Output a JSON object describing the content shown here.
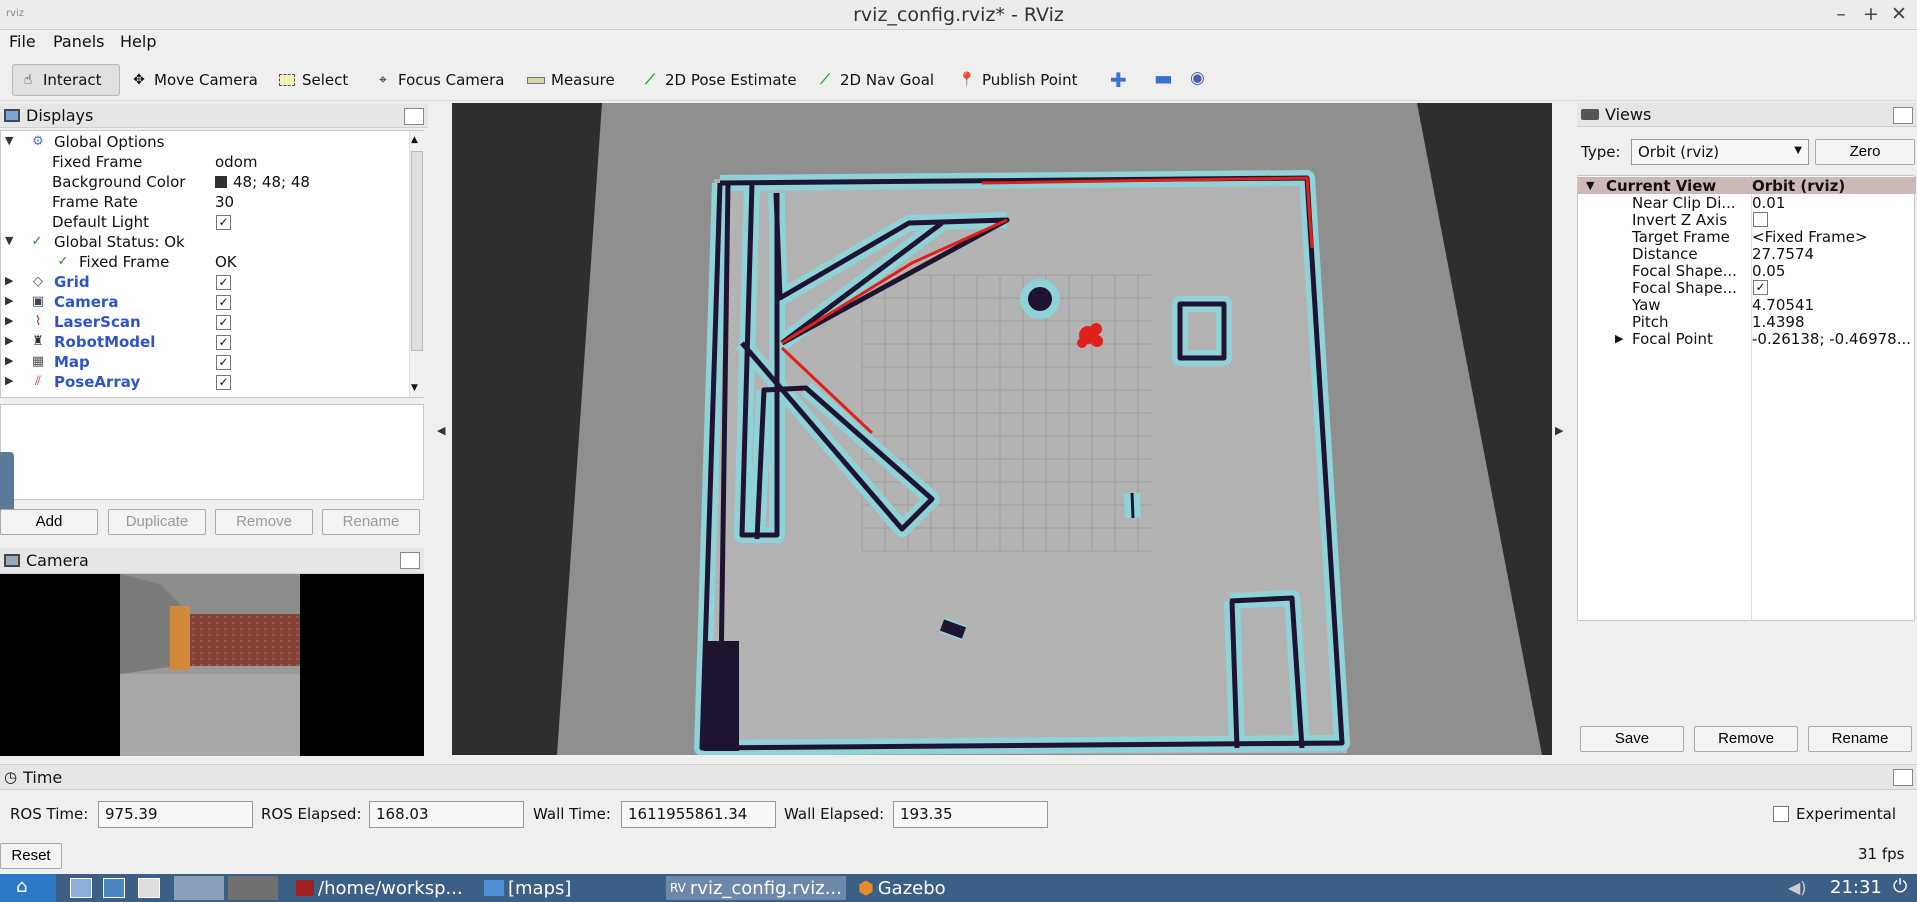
{
  "window": {
    "title": "rviz_config.rviz* - RViz",
    "app_label": "rviz"
  },
  "menu": [
    "File",
    "Panels",
    "Help"
  ],
  "toolbar": [
    {
      "label": "Interact",
      "icon": "cursor-icon",
      "active": true
    },
    {
      "label": "Move Camera",
      "icon": "move-icon"
    },
    {
      "label": "Select",
      "icon": "select-icon"
    },
    {
      "label": "Focus Camera",
      "icon": "focus-icon"
    },
    {
      "label": "Measure",
      "icon": "ruler-icon"
    },
    {
      "label": "2D Pose Estimate",
      "icon": "green-arrow-icon"
    },
    {
      "label": "2D Nav Goal",
      "icon": "green-arrow-icon"
    },
    {
      "label": "Publish Point",
      "icon": "pin-icon"
    }
  ],
  "displays": {
    "title": "Displays",
    "rows": [
      {
        "key": "Global Options",
        "expanded": true
      },
      {
        "key": "Fixed Frame",
        "value": "odom"
      },
      {
        "key": "Background Color",
        "value": "48; 48; 48"
      },
      {
        "key": "Frame Rate",
        "value": "30"
      },
      {
        "key": "Default Light",
        "value": "✓"
      },
      {
        "key": "Global Status: Ok",
        "expanded": true
      },
      {
        "key": "Fixed Frame",
        "value": "OK"
      },
      {
        "key": "Grid",
        "value": "✓"
      },
      {
        "key": "Camera",
        "value": "✓"
      },
      {
        "key": "LaserScan",
        "value": "✓"
      },
      {
        "key": "RobotModel",
        "value": "✓"
      },
      {
        "key": "Map",
        "value": "✓"
      },
      {
        "key": "PoseArray",
        "value": "✓"
      }
    ],
    "buttons": [
      "Add",
      "Duplicate",
      "Remove",
      "Rename"
    ]
  },
  "camera_panel": {
    "title": "Camera"
  },
  "views": {
    "title": "Views",
    "type_label": "Type:",
    "type_value": "Orbit (rviz)",
    "zero": "Zero",
    "current_view": "Current View",
    "current_view_value": "Orbit (rviz)",
    "props": [
      {
        "key": "Near Clip Di...",
        "value": "0.01"
      },
      {
        "key": "Invert Z Axis",
        "value": ""
      },
      {
        "key": "Target Frame",
        "value": "<Fixed Frame>"
      },
      {
        "key": "Distance",
        "value": "27.7574"
      },
      {
        "key": "Focal Shape...",
        "value": "0.05"
      },
      {
        "key": "Focal Shape...",
        "value": "✓"
      },
      {
        "key": "Yaw",
        "value": "4.70541"
      },
      {
        "key": "Pitch",
        "value": "1.4398"
      },
      {
        "key": "Focal Point",
        "value": "-0.26138; -0.46978..."
      }
    ],
    "buttons": [
      "Save",
      "Remove",
      "Rename"
    ]
  },
  "time": {
    "title": "Time",
    "ros_time_label": "ROS Time:",
    "ros_time": "975.39",
    "ros_elapsed_label": "ROS Elapsed:",
    "ros_elapsed": "168.03",
    "wall_time_label": "Wall Time:",
    "wall_time": "1611955861.34",
    "wall_elapsed_label": "Wall Elapsed:",
    "wall_elapsed": "193.35",
    "experimental": "Experimental",
    "reset": "Reset",
    "fps": "31 fps"
  },
  "taskbar": {
    "items": [
      "/home/worksp...",
      "[maps]",
      "rviz_config.rviz...",
      "Gazebo"
    ],
    "clock": "21:31"
  }
}
